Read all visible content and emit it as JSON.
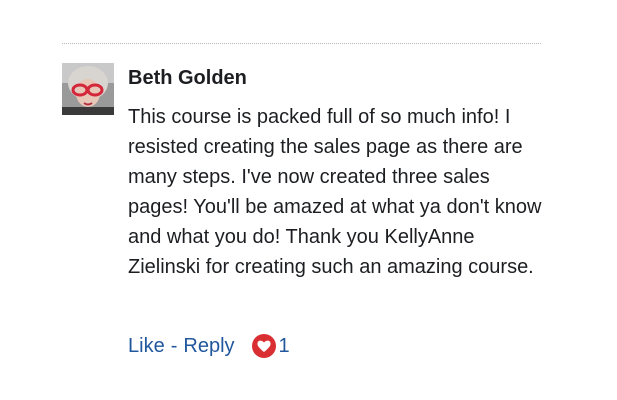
{
  "comment": {
    "author": "Beth Golden",
    "text": "This course is packed full of so much info! I resisted creating the sales page as there are many steps. I've now created three sales pages! You'll be amazed at what ya don't know and what you do! Thank you KellyAnne Zielinski for creating such an amazing course.",
    "actions": {
      "like_label": "Like",
      "separator": "-",
      "reply_label": "Reply"
    },
    "reactions": {
      "icon": "heart-icon",
      "count": "1",
      "color": "#d92f33"
    }
  },
  "colors": {
    "link": "#21579d",
    "text": "#1c1e21"
  }
}
